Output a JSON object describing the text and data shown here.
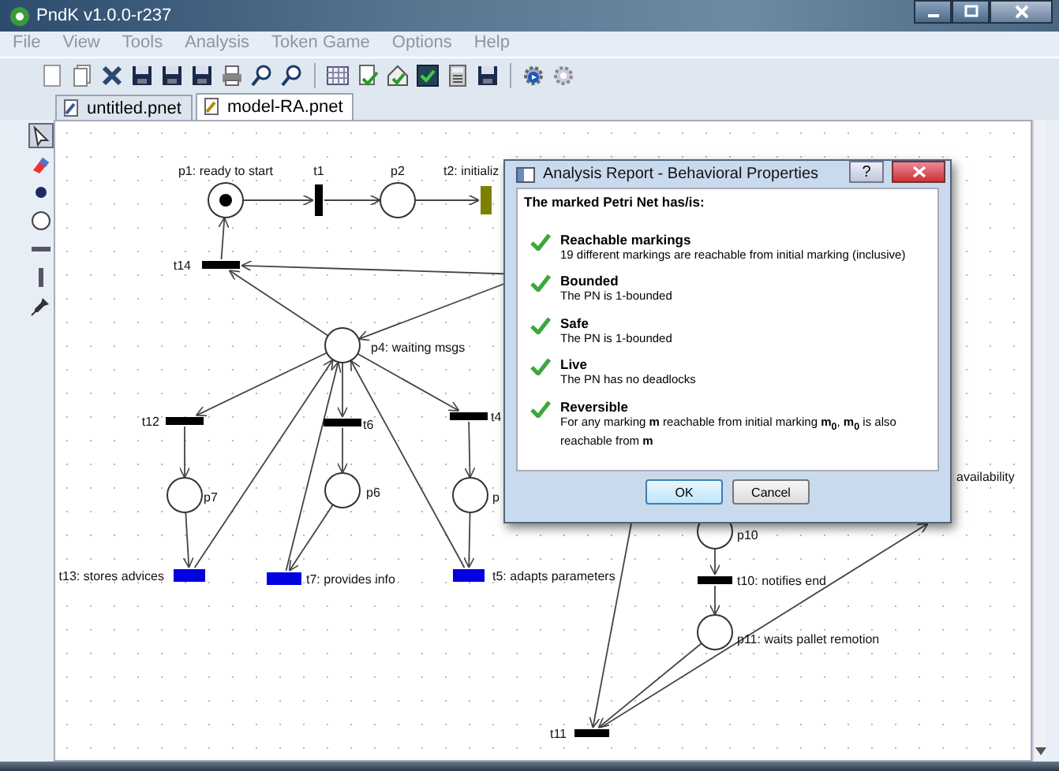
{
  "window": {
    "title": "PndK v1.0.0-r237"
  },
  "menu": [
    {
      "label": "File",
      "disabled": true
    },
    {
      "label": "View",
      "disabled": true
    },
    {
      "label": "Tools",
      "disabled": true
    },
    {
      "label": "Analysis",
      "disabled": true
    },
    {
      "label": "Token Game",
      "disabled": true
    },
    {
      "label": "Options",
      "disabled": true
    },
    {
      "label": "Help",
      "disabled": true
    }
  ],
  "tabs": [
    {
      "label": "untitled.pnet",
      "selected": false
    },
    {
      "label": "model-RA.pnet",
      "selected": true
    }
  ],
  "palette": [
    {
      "kind": "pointer",
      "selected": true
    },
    {
      "kind": "eraser",
      "selected": false
    },
    {
      "kind": "token",
      "selected": false
    },
    {
      "kind": "place",
      "selected": false
    },
    {
      "kind": "htransition",
      "selected": false
    },
    {
      "kind": "vtransition",
      "selected": false
    },
    {
      "kind": "pin",
      "selected": false
    }
  ],
  "net": {
    "places": [
      {
        "label": "p1: ready to start",
        "marked": true
      },
      {
        "label": "p2",
        "marked": false
      },
      {
        "label": "p4: waiting msgs",
        "marked": false
      },
      {
        "label": "p7",
        "marked": false
      },
      {
        "label": "p6",
        "marked": false
      },
      {
        "label": "p",
        "marked": false
      },
      {
        "label": "p10",
        "marked": false
      },
      {
        "label": "p11: waits pallet remotion",
        "marked": false
      }
    ],
    "transitions": [
      {
        "label": "t1",
        "color": "#000000"
      },
      {
        "label": "t2: initializ",
        "color": "#808000"
      },
      {
        "label": "t14",
        "color": "#000000"
      },
      {
        "label": "t12",
        "color": "#000000"
      },
      {
        "label": "t6",
        "color": "#000000"
      },
      {
        "label": "t4",
        "color": "#000000"
      },
      {
        "label": "t13: stores advices",
        "color": "#0000e0"
      },
      {
        "label": "t7: provides info",
        "color": "#0000e0"
      },
      {
        "label": "t5: adapts parameters",
        "color": "#0000e0"
      },
      {
        "label": "t10: notifies end",
        "color": "#000000"
      },
      {
        "label": "t11",
        "color": "#000000"
      }
    ],
    "fragments": [
      "availability"
    ]
  },
  "dialog": {
    "title": "Analysis Report - Behavioral Properties",
    "help": "?",
    "heading": "The marked Petri Net has/is:",
    "properties": [
      {
        "title": "Reachable markings",
        "text": "19 different markings are reachable from initial marking (inclusive)",
        "checked": true
      },
      {
        "title": "Bounded",
        "text": "The PN is 1-bounded",
        "checked": true
      },
      {
        "title": "Safe",
        "text": "The PN is 1-bounded",
        "checked": true
      },
      {
        "title": "Live",
        "text": "The PN has no deadlocks",
        "checked": true
      },
      {
        "title": "Reversible",
        "text": "For any marking **m** reachable from initial marking **m$_{0}$**, **m$_{0}$** is also reachable from **m**",
        "checked": true
      }
    ],
    "buttons": [
      {
        "label": "OK",
        "default": true
      },
      {
        "label": "Cancel",
        "default": false
      }
    ]
  }
}
